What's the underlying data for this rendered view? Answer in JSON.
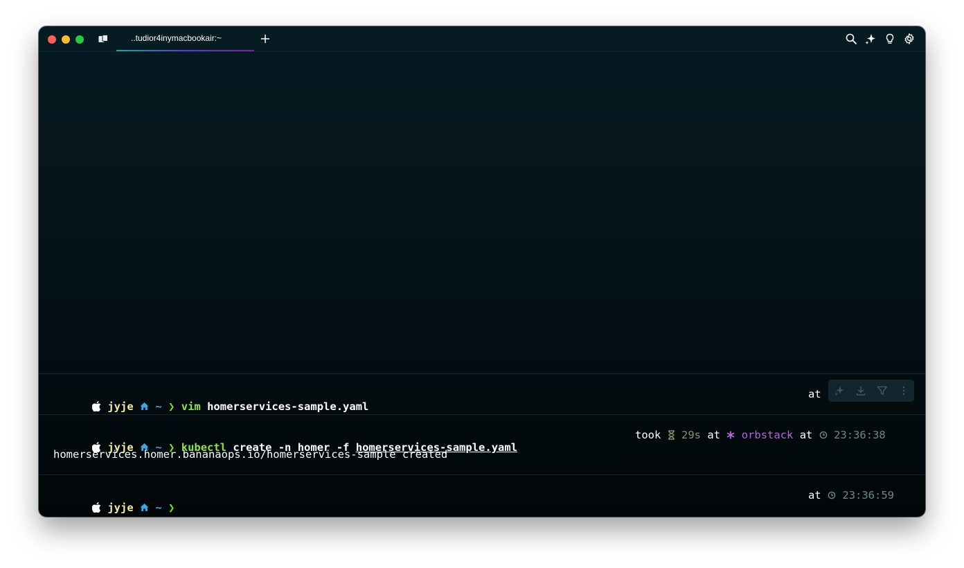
{
  "window": {
    "tab_title": "..tudior4inymacbookair:~"
  },
  "titlebar": {
    "tools": [
      "search-icon",
      "ai-sparkle-icon",
      "lightbulb-icon",
      "settings-gear-icon"
    ]
  },
  "prompt": {
    "user": "jyje",
    "dir": "~",
    "arrow": "❯"
  },
  "blocks": [
    {
      "command": "vim",
      "args": "homerservices-sample.yaml",
      "right_at": "at"
    },
    {
      "command": "kubectl",
      "args_plain": "create -n homer -f",
      "args_file": "homerservices-sample.yaml",
      "took_label": "took",
      "duration": "29s",
      "at1": "at",
      "context": "orbstack",
      "at2": "at",
      "time": "23:36:38",
      "output": "homerservices.homer.bananaops.io/homerservices-sample created"
    },
    {
      "right_at": "at",
      "time": "23:36:59"
    }
  ],
  "colors": {
    "user": "#f3e7a2",
    "dir": "#3aa7e8",
    "arrow": "#7adf2b",
    "command": "#8ce24a",
    "context": "#b565d8",
    "background": "#041318"
  }
}
